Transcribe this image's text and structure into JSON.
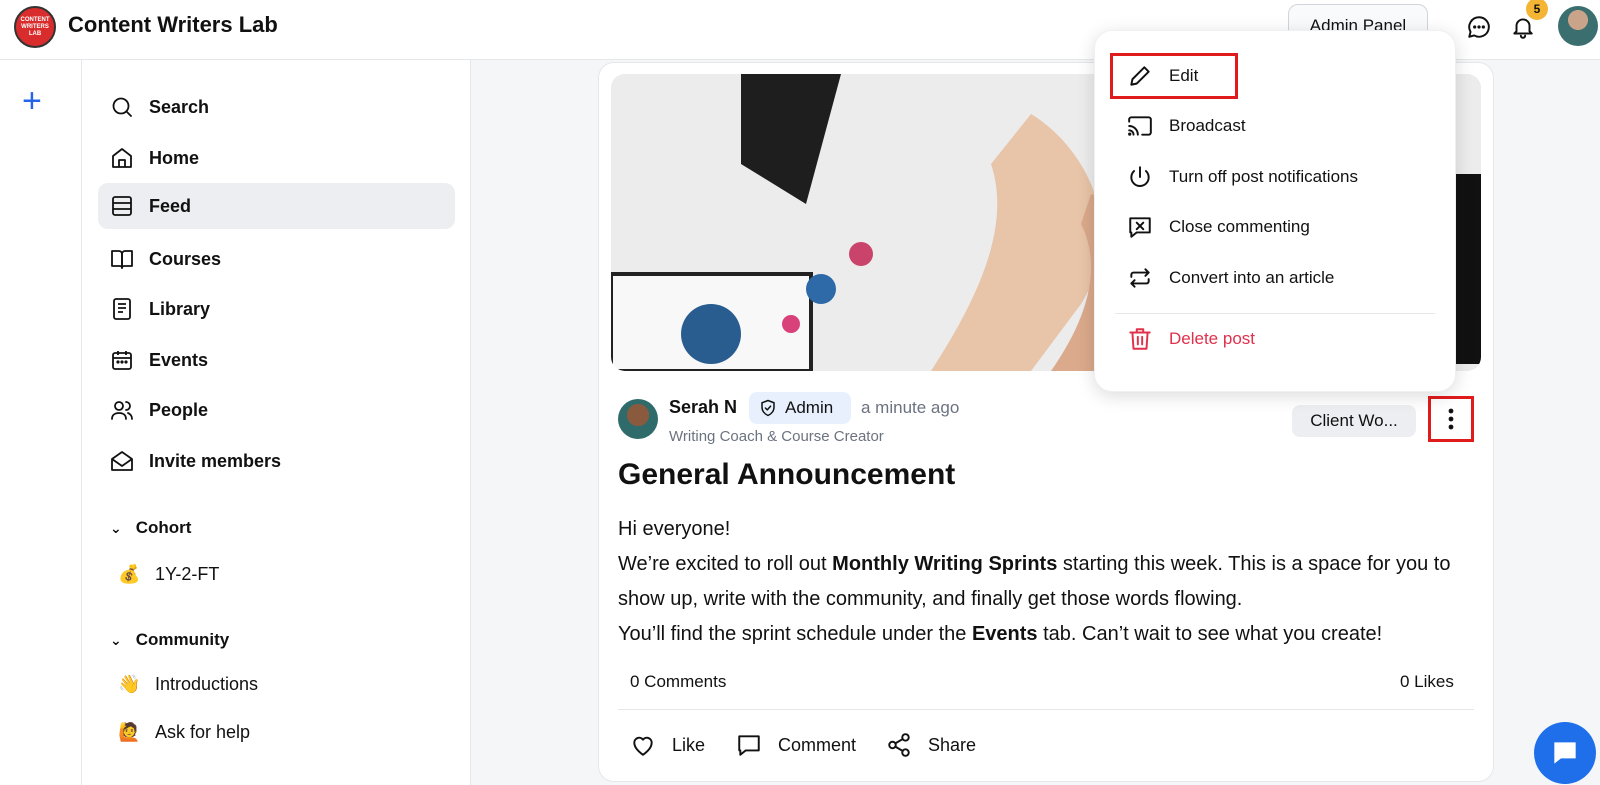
{
  "header": {
    "logo_text": [
      "CONTENT",
      "WRITERS",
      "LAB"
    ],
    "brand": "Content Writers Lab",
    "admin_panel": "Admin Panel",
    "notification_count": "5"
  },
  "rail": {
    "add_label": "+"
  },
  "sidebar": {
    "items": [
      {
        "label": "Search",
        "icon": "search-icon"
      },
      {
        "label": "Home",
        "icon": "home-icon"
      },
      {
        "label": "Feed",
        "icon": "feed-icon",
        "active": true
      },
      {
        "label": "Courses",
        "icon": "book-icon"
      },
      {
        "label": "Library",
        "icon": "library-icon"
      },
      {
        "label": "Events",
        "icon": "calendar-icon"
      },
      {
        "label": "People",
        "icon": "people-icon"
      },
      {
        "label": "Invite members",
        "icon": "envelope-icon"
      }
    ],
    "sections": [
      {
        "title": "Cohort",
        "items": [
          {
            "emoji": "💰",
            "label": "1Y-2-FT"
          }
        ]
      },
      {
        "title": "Community",
        "items": [
          {
            "emoji": "👋",
            "label": "Introductions"
          },
          {
            "emoji": "🙋",
            "label": "Ask for help"
          }
        ]
      }
    ]
  },
  "post": {
    "author": "Serah N",
    "badge": "Admin",
    "time": "a minute ago",
    "author_subtitle": "Writing Coach & Course Creator",
    "tag": "Client Wo...",
    "title": "General Announcement",
    "body": {
      "line1": "Hi everyone!",
      "line2_pre": "We’re excited to roll out ",
      "line2_bold": "Monthly Writing Sprints",
      "line2_post": " starting this week. This is a space for you to show up, write with the community, and finally get those words flowing.",
      "line3_pre": "You’ll find the sprint schedule under the ",
      "line3_bold": "Events",
      "line3_post": " tab. Can’t wait to see what you create!"
    },
    "comments": "0 Comments",
    "likes": "0 Likes",
    "actions": {
      "like": "Like",
      "comment": "Comment",
      "share": "Share"
    }
  },
  "menu": {
    "edit": "Edit",
    "broadcast": "Broadcast",
    "notifications": "Turn off post notifications",
    "close_commenting": "Close commenting",
    "convert": "Convert into an article",
    "delete": "Delete post"
  },
  "colors": {
    "accent": "#2563eb",
    "danger": "#e0314b",
    "highlight": "#e01b1b",
    "badge": "#f5b534"
  }
}
